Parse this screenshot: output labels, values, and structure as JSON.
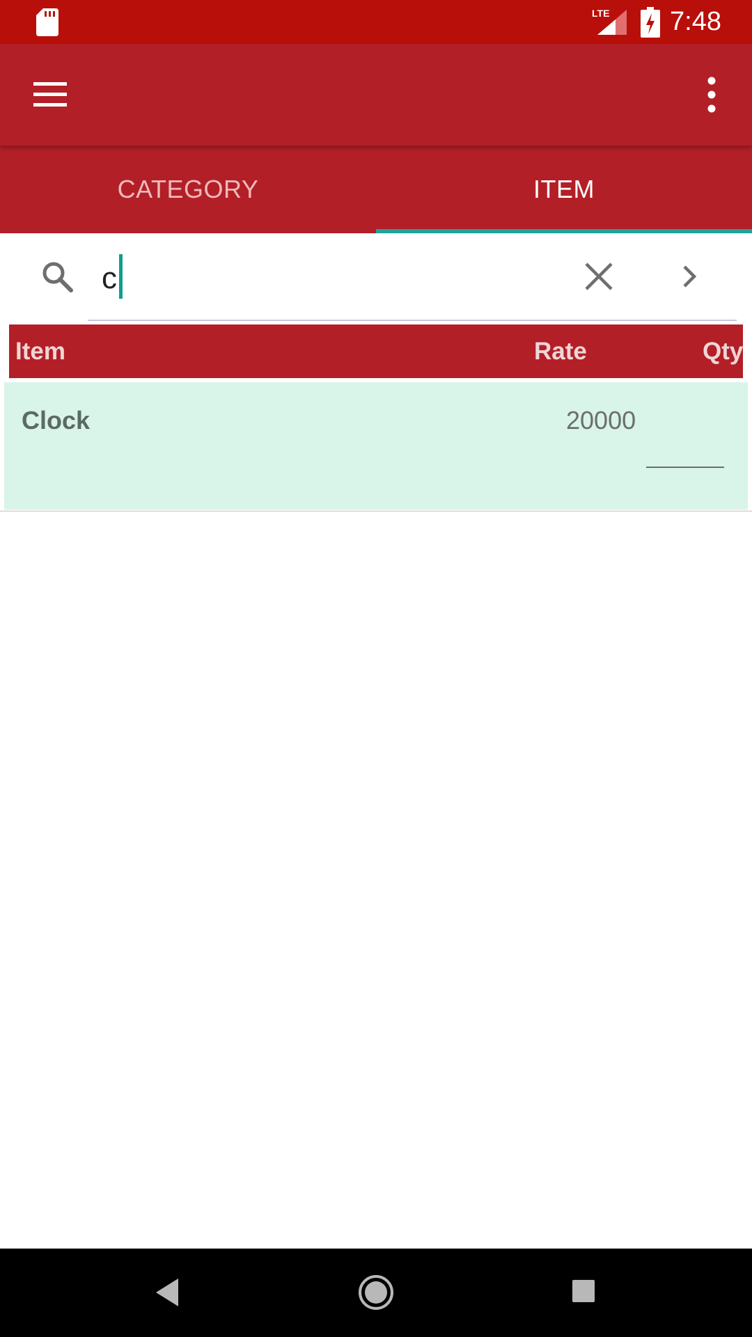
{
  "status_bar": {
    "time": "7:48",
    "network_label": "LTE",
    "icons": [
      "sd-card-icon",
      "lte-signal-icon",
      "battery-charging-icon"
    ],
    "background": "#b90f0a"
  },
  "app_bar": {
    "icons": [
      "hamburger-menu-icon",
      "more-vert-icon"
    ],
    "background": "#b31f27"
  },
  "tabs": [
    {
      "label": "CATEGORY",
      "selected": false
    },
    {
      "label": "ITEM",
      "selected": true
    }
  ],
  "tab_indicator_color": "#20a39b",
  "search": {
    "value": "c",
    "icons": [
      "search-icon",
      "clear-icon",
      "chevron-right-icon"
    ]
  },
  "table": {
    "columns": [
      "Item",
      "Rate",
      "Qty"
    ],
    "rows": [
      {
        "item": "Clock",
        "rate": "20000",
        "qty": ""
      }
    ],
    "row_background": "#d9f4e8"
  },
  "nav_bar": {
    "icons": [
      "back-icon",
      "home-icon",
      "recents-icon"
    ]
  }
}
